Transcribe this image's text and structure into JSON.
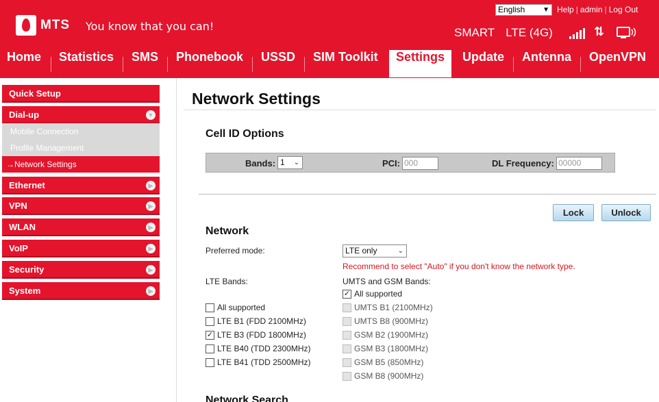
{
  "header": {
    "brand": "MTS",
    "slogan": "You know that you can!",
    "language": "English",
    "links": {
      "help": "Help",
      "user": "admin",
      "logout": "Log Out"
    },
    "operator": "SMART",
    "network": "LTE (4G)",
    "signal_bars": 5,
    "updown_glyph": "⇅",
    "brand_color": "#e3142c"
  },
  "nav": {
    "items": [
      "Home",
      "Statistics",
      "SMS",
      "Phonebook",
      "USSD",
      "SIM Toolkit",
      "Settings",
      "Update",
      "Antenna",
      "OpenVPN"
    ],
    "active": "Settings"
  },
  "sidebar": {
    "quick_setup": "Quick Setup",
    "dialup": "Dial-up",
    "dialup_subs": [
      "Mobile Connection",
      "Profile Management",
      "Network Settings"
    ],
    "active_sub_prefix": "→",
    "sections": [
      "Ethernet",
      "VPN",
      "WLAN",
      "VoIP",
      "Security",
      "System"
    ]
  },
  "main": {
    "title": "Network Settings",
    "cell_id": {
      "heading": "Cell ID Options",
      "bands_label": "Bands:",
      "bands_value": "1",
      "pci_label": "PCI:",
      "pci_placeholder": "000",
      "dl_label": "DL Frequency:",
      "dl_placeholder": "00000"
    },
    "buttons": {
      "lock": "Lock",
      "unlock": "Unlock"
    },
    "network": {
      "heading": "Network",
      "preferred_mode_label": "Preferred mode:",
      "preferred_mode_value": "LTE only",
      "warning": "Recommend to select \"Auto\" if you don't know the network type.",
      "lte_bands_label": "LTE Bands:",
      "umts_gsm_label": "UMTS and GSM Bands:",
      "lte_bands": [
        {
          "label": "All supported",
          "checked": false
        },
        {
          "label": "LTE B1 (FDD 2100MHz)",
          "checked": false
        },
        {
          "label": "LTE B3 (FDD 1800MHz)",
          "checked": true
        },
        {
          "label": "LTE B40 (TDD 2300MHz)",
          "checked": false
        },
        {
          "label": "LTE B41 (TDD 2500MHz)",
          "checked": false
        }
      ],
      "umts_bands": [
        {
          "label": "All supported",
          "checked": true,
          "disabled": false
        },
        {
          "label": "UMTS B1 (2100MHz)",
          "checked": false,
          "disabled": true
        },
        {
          "label": "UMTS B8 (900MHz)",
          "checked": false,
          "disabled": true
        },
        {
          "label": "GSM B2 (1900MHz)",
          "checked": false,
          "disabled": true
        },
        {
          "label": "GSM B3 (1800MHz)",
          "checked": false,
          "disabled": true
        },
        {
          "label": "GSM B5 (850MHz)",
          "checked": false,
          "disabled": true
        },
        {
          "label": "GSM B8 (900MHz)",
          "checked": false,
          "disabled": true
        }
      ]
    },
    "next_heading": "Network Search"
  }
}
